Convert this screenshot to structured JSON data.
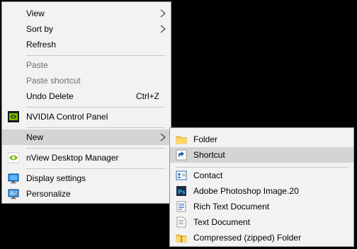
{
  "context_menu": {
    "items": [
      {
        "label": "View"
      },
      {
        "label": "Sort by"
      },
      {
        "label": "Refresh"
      },
      {
        "label": "Paste"
      },
      {
        "label": "Paste shortcut"
      },
      {
        "label": "Undo Delete",
        "accelerator": "Ctrl+Z"
      },
      {
        "label": "NVIDIA Control Panel"
      },
      {
        "label": "New"
      },
      {
        "label": "nView Desktop Manager"
      },
      {
        "label": "Display settings"
      },
      {
        "label": "Personalize"
      }
    ]
  },
  "new_submenu": {
    "items": [
      {
        "label": "Folder"
      },
      {
        "label": "Shortcut"
      },
      {
        "label": "Contact"
      },
      {
        "label": "Adobe Photoshop Image.20"
      },
      {
        "label": "Rich Text Document"
      },
      {
        "label": "Text Document"
      },
      {
        "label": "Compressed (zipped) Folder"
      }
    ]
  },
  "colors": {
    "menu_background": "#f2f2f2",
    "hover_background": "#d4d4d4",
    "disabled_text": "#6d6d6d",
    "nvidia_green": "#76b900"
  },
  "icons": {
    "nvidia": "nvidia-icon",
    "nview": "nview-icon",
    "display": "display-icon",
    "personalize": "personalize-icon",
    "folder": "folder-icon",
    "shortcut": "shortcut-icon",
    "contact": "contact-icon",
    "photoshop": "photoshop-icon",
    "rich_text": "rich-text-icon",
    "text": "text-document-icon",
    "zip": "zip-folder-icon"
  }
}
